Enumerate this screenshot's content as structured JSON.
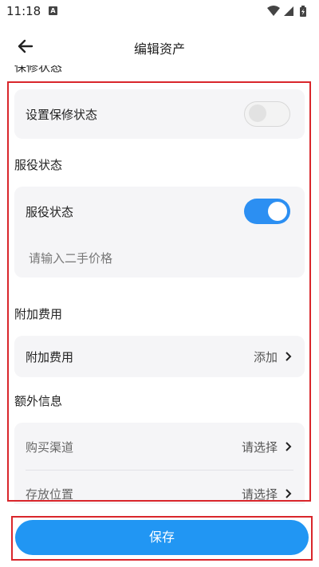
{
  "status_bar": {
    "time": "11:18",
    "notification_icon": "A"
  },
  "header": {
    "title": "编辑资产"
  },
  "content": {
    "cut_off_label": "保修状态",
    "warranty_card": {
      "label": "设置保修状态",
      "toggle_on": false
    },
    "service_section": {
      "label": "服役状态"
    },
    "service_card": {
      "toggle_label": "服役状态",
      "toggle_on": true,
      "price_placeholder": "请输入二手价格"
    },
    "extra_fee_section": {
      "label": "附加费用"
    },
    "extra_fee_card": {
      "label": "附加费用",
      "value": "添加"
    },
    "extra_info_section": {
      "label": "额外信息"
    },
    "extra_info_card": {
      "rows": [
        {
          "label": "购买渠道",
          "value": "请选择"
        },
        {
          "label": "存放位置",
          "value": "请选择"
        }
      ]
    }
  },
  "footer": {
    "save_label": "保存"
  },
  "colors": {
    "accent": "#2196f3",
    "highlight": "#d9262b",
    "card_bg": "#f5f5f7"
  },
  "icons": [
    "back-arrow-icon",
    "wifi-icon",
    "signal-icon",
    "battery-icon",
    "chevron-right-icon"
  ]
}
